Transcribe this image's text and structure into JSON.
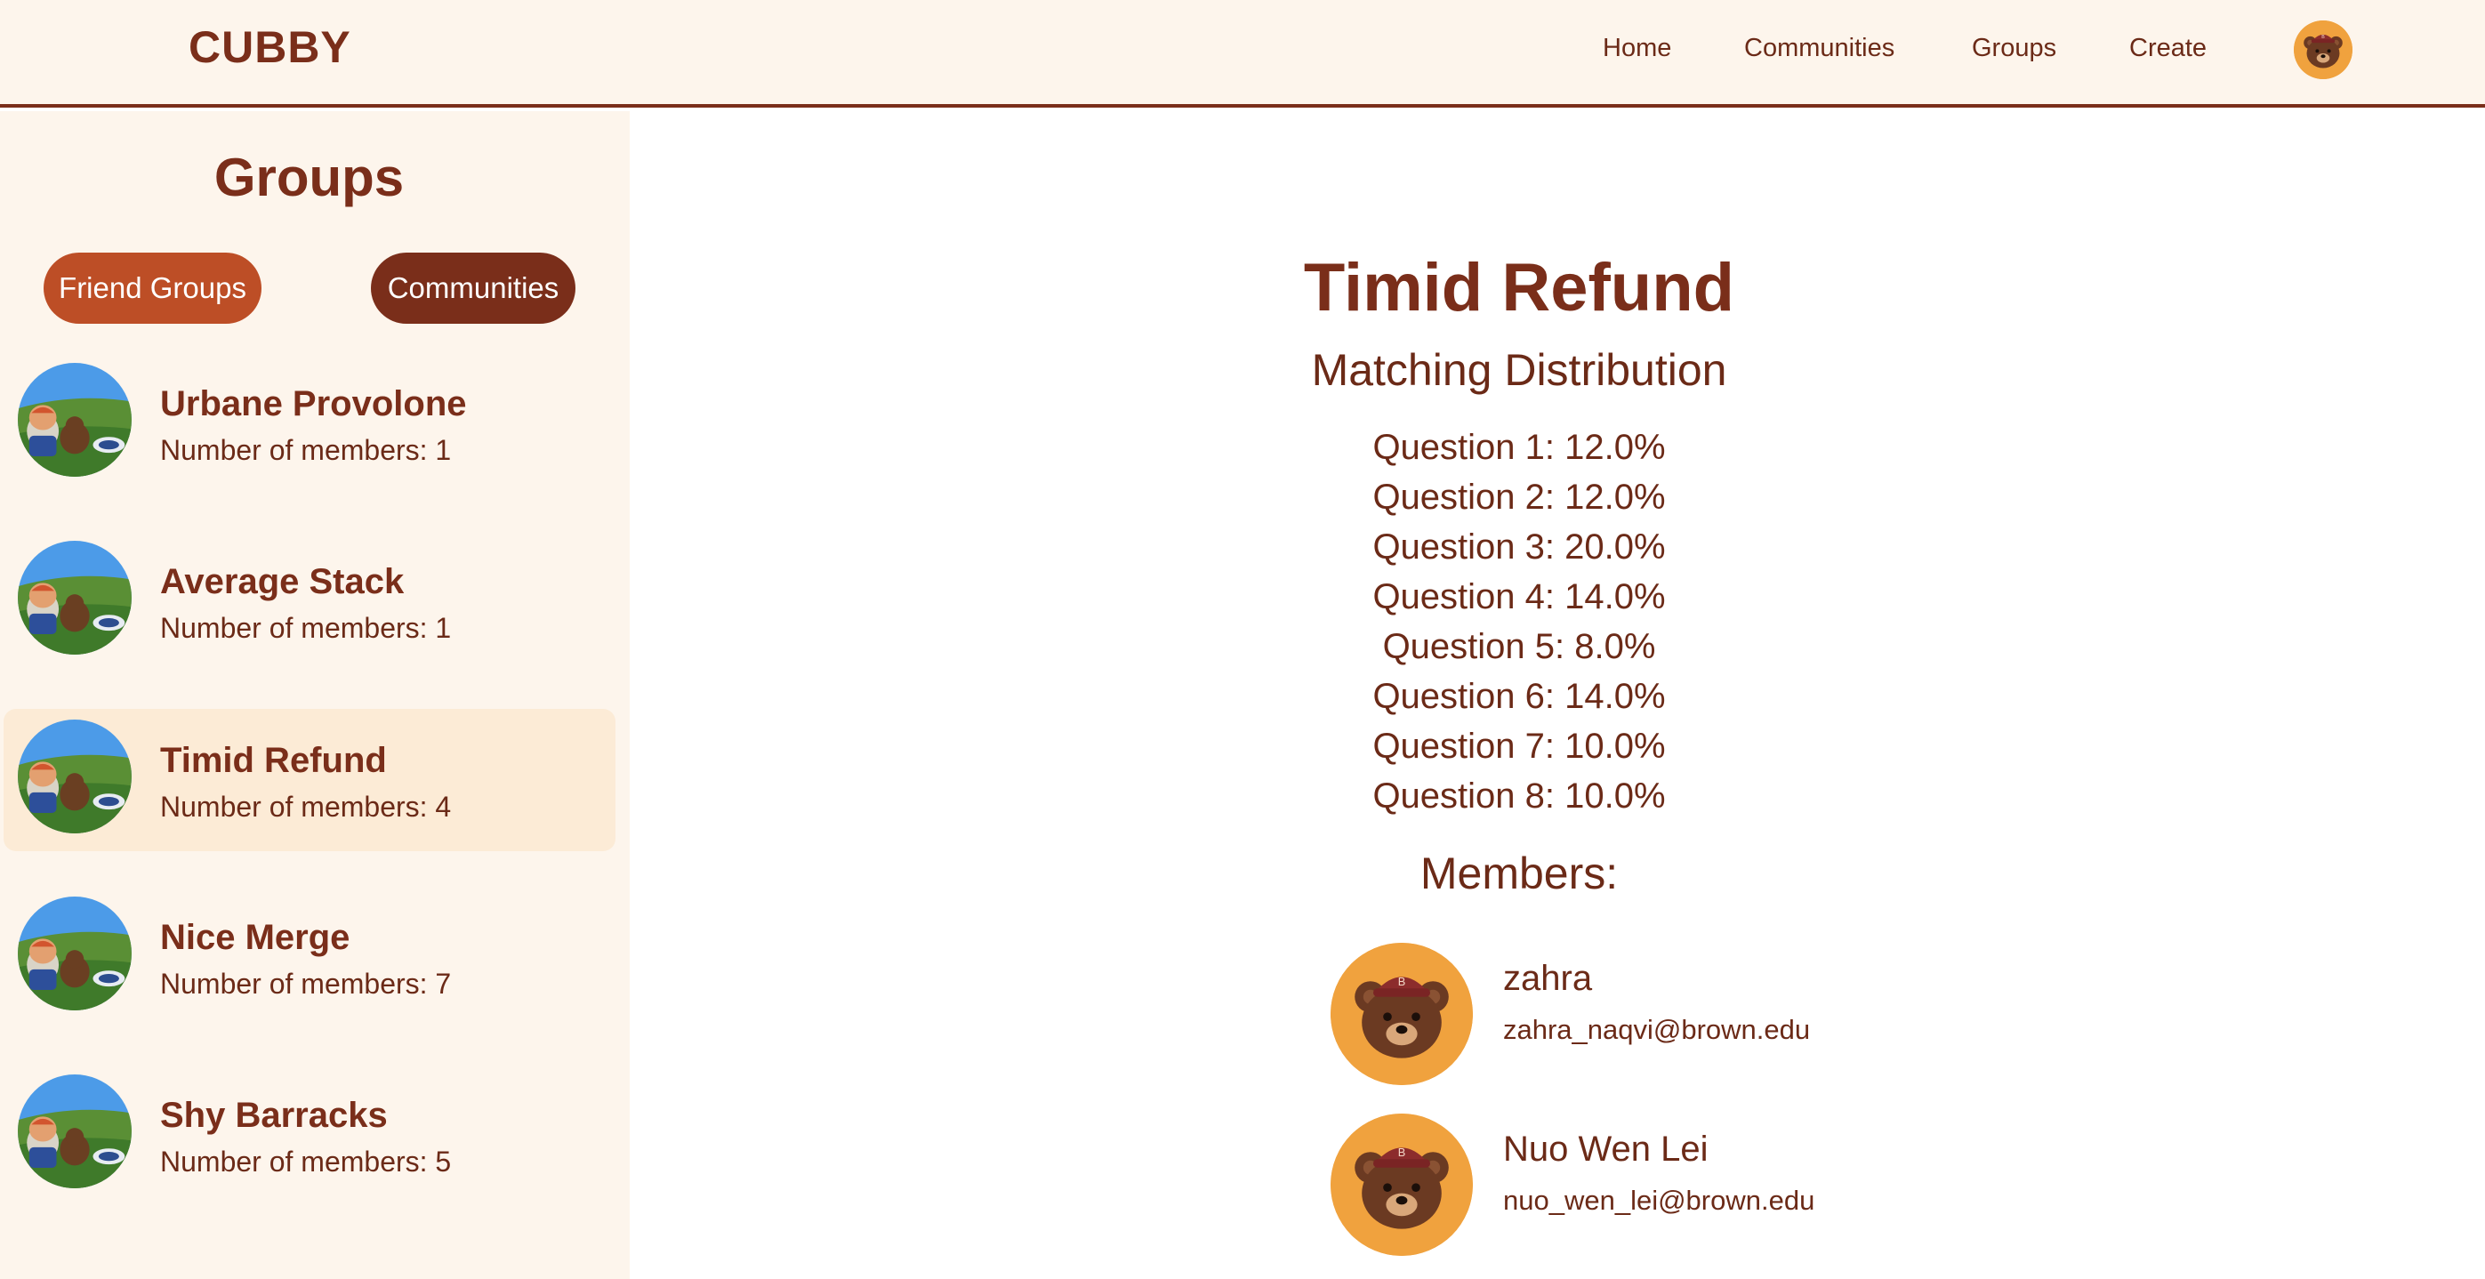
{
  "navbar": {
    "brand": "CUBBY",
    "links": [
      "Home",
      "Communities",
      "Groups",
      "Create"
    ],
    "avatar_icon": "bear-avatar-icon"
  },
  "sidebar": {
    "title": "Groups",
    "tabs": {
      "friend_groups": "Friend Groups",
      "communities": "Communities"
    },
    "groups": [
      {
        "name": "Urbane Provolone",
        "members": "Number of members: 1"
      },
      {
        "name": "Average Stack",
        "members": "Number of members: 1"
      },
      {
        "name": "Timid Refund",
        "members": "Number of members: 4",
        "selected": true
      },
      {
        "name": "Nice Merge",
        "members": "Number of members: 7"
      },
      {
        "name": "Shy Barracks",
        "members": "Number of members: 5"
      }
    ]
  },
  "main": {
    "title": "Timid Refund",
    "distribution_heading": "Matching Distribution",
    "questions": [
      "Question 1: 12.0%",
      "Question 2: 12.0%",
      "Question 3: 20.0%",
      "Question 4: 14.0%",
      "Question 5: 8.0%",
      "Question 6: 14.0%",
      "Question 7: 10.0%",
      "Question 8: 10.0%"
    ],
    "members_heading": "Members:",
    "members": [
      {
        "name": "zahra",
        "email": "zahra_naqvi@brown.edu"
      },
      {
        "name": "Nuo Wen Lei",
        "email": "nuo_wen_lei@brown.edu"
      }
    ]
  },
  "colors": {
    "brown": "#7a2e1a",
    "orange_pill": "#bd4e26",
    "cream": "#fdf5ec",
    "selected_bg": "#fcebd6",
    "avatar_orange": "#f0a23e"
  }
}
